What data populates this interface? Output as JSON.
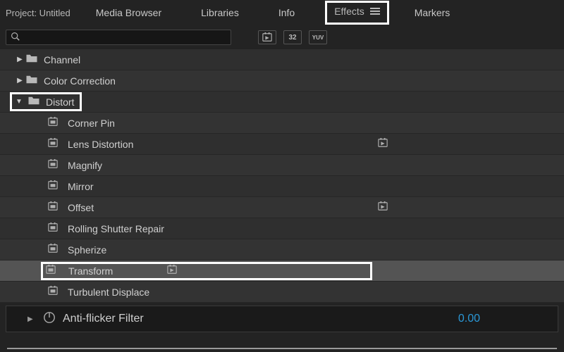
{
  "tabs": {
    "project": "Project: Untitled",
    "media_browser": "Media Browser",
    "libraries": "Libraries",
    "info": "Info",
    "effects": "Effects",
    "markers": "Markers"
  },
  "search": {
    "placeholder": ""
  },
  "filters": {
    "accel": "▸▸",
    "bit32": "32",
    "yuv": "YUV"
  },
  "tree": {
    "channel": "Channel",
    "color_correction": "Color Correction",
    "distort": "Distort",
    "items": {
      "corner_pin": "Corner Pin",
      "lens_distortion": "Lens Distortion",
      "magnify": "Magnify",
      "mirror": "Mirror",
      "offset": "Offset",
      "rolling_shutter": "Rolling Shutter Repair",
      "spherize": "Spherize",
      "transform": "Transform",
      "turbulent": "Turbulent Displace"
    }
  },
  "bottom": {
    "param_name": "Anti-flicker Filter",
    "param_value": "0.00"
  }
}
